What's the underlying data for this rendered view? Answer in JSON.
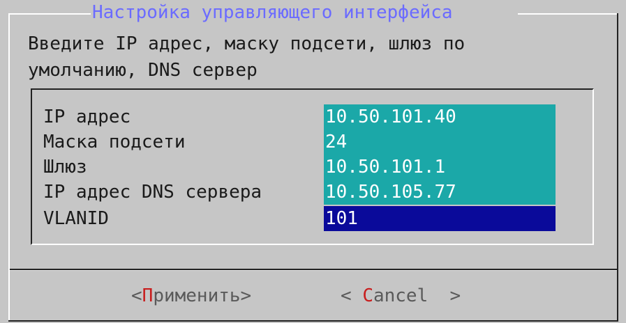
{
  "dialog": {
    "title": "Настройка управляющего интерфейса",
    "description_line1": "Введите IP адрес, маску подсети, шлюз по",
    "description_line2": "умолчанию, DNS сервер"
  },
  "form": {
    "fields": [
      {
        "label": "IP адрес",
        "value": "10.50.101.40"
      },
      {
        "label": "Маска подсети",
        "value": "24"
      },
      {
        "label": "Шлюз",
        "value": "10.50.101.1"
      },
      {
        "label": "IP адрес DNS сервера",
        "value": "10.50.105.77"
      },
      {
        "label": "VLANID",
        "value": "101"
      }
    ]
  },
  "buttons": {
    "apply_prefix": "<",
    "apply_hotkey": "П",
    "apply_rest": "рименить>",
    "cancel_prefix": "< ",
    "cancel_hotkey": "C",
    "cancel_rest": "ancel  >"
  },
  "colors": {
    "background": "#c6c6c6",
    "title": "#6b6bff",
    "field_value": "#1ba8a8",
    "field_active": "#0a0a9a",
    "hotkey": "#c81e1e"
  }
}
